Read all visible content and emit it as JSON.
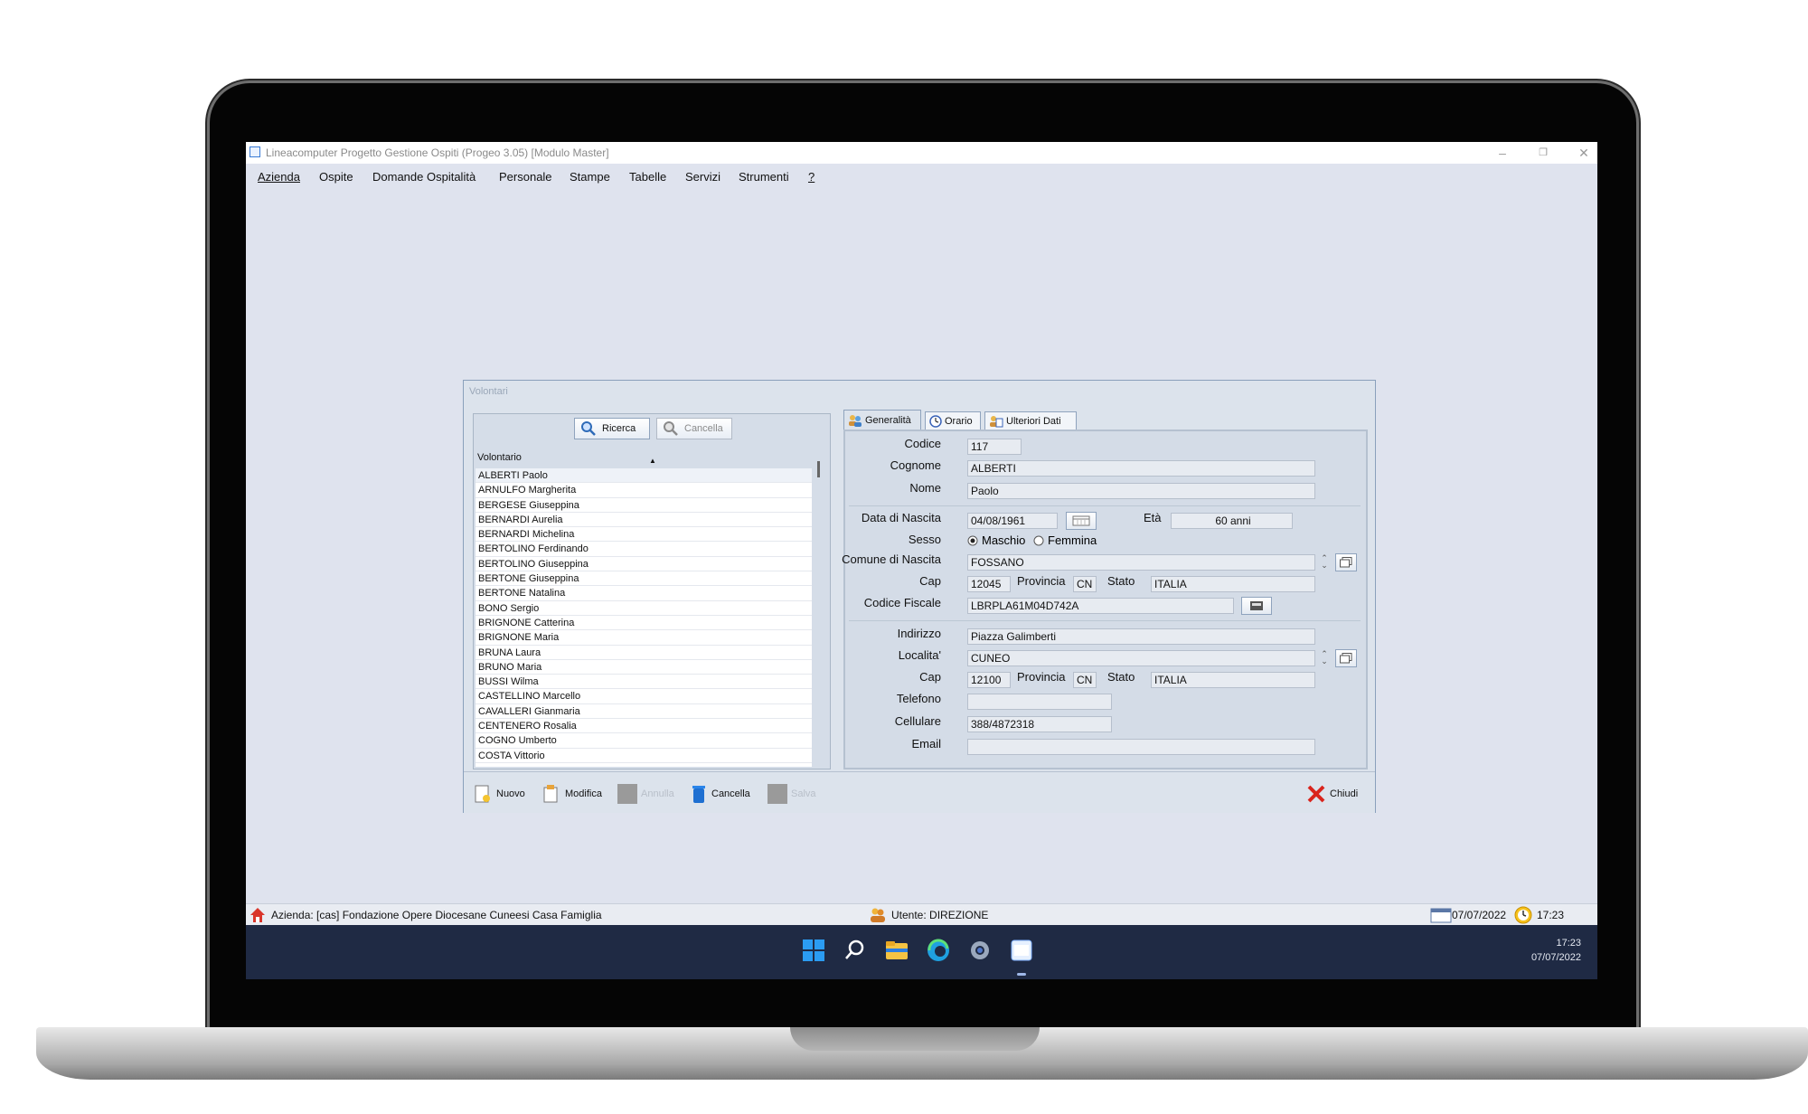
{
  "window": {
    "title": "Lineacomputer Progetto Gestione Ospiti (Progeo 3.05) [Modulo Master]",
    "controls": {
      "minimize": "–",
      "restore": "❐",
      "close": "✕"
    }
  },
  "menu": [
    "Azienda",
    "Ospite",
    "Domande Ospitalità",
    "Personale",
    "Stampe",
    "Tabelle",
    "Servizi",
    "Strumenti",
    "?"
  ],
  "dialog": {
    "title": "Volontari",
    "search_button": "Ricerca",
    "clear_button": "Cancella",
    "list_header": "Volontario",
    "volunteers": [
      "ALBERTI Paolo",
      "ARNULFO  Margherita",
      "BERGESE Giuseppina",
      "BERNARDI Aurelia",
      "BERNARDI Michelina",
      "BERTOLINO Ferdinando",
      "BERTOLINO Giuseppina",
      "BERTONE Giuseppina",
      "BERTONE Natalina",
      "BONO Sergio",
      "BRIGNONE  Catterina",
      "BRIGNONE Maria",
      "BRUNA Laura",
      "BRUNO Maria",
      "BUSSI Wilma",
      "CASTELLINO Marcello",
      "CAVALLERI Gianmaria",
      "CENTENERO Rosalia",
      "COGNO Umberto",
      "COSTA Vittorio"
    ],
    "tabs": [
      "Generalità",
      "Orario",
      "Ulteriori Dati"
    ],
    "form": {
      "codice_label": "Codice",
      "codice": "117",
      "cognome_label": "Cognome",
      "cognome": "ALBERTI",
      "nome_label": "Nome",
      "nome": "Paolo",
      "data_nascita_label": "Data di Nascita",
      "data_nascita": "04/08/1961",
      "eta_label": "Età",
      "eta": "60 anni",
      "sesso_label": "Sesso",
      "sesso_m": "Maschio",
      "sesso_f": "Femmina",
      "comune_label": "Comune di Nascita",
      "comune": "FOSSANO",
      "cap_label": "Cap",
      "cap_nascita": "12045",
      "provincia_label": "Provincia",
      "provincia_nascita": "CN",
      "stato_label": "Stato",
      "stato_nascita": "ITALIA",
      "cf_label": "Codice Fiscale",
      "cf": "LBRPLA61M04D742A",
      "indirizzo_label": "Indirizzo",
      "indirizzo": "Piazza Galimberti",
      "localita_label": "Localita'",
      "localita": "CUNEO",
      "cap_res": "12100",
      "provincia_res": "CN",
      "stato_res": "ITALIA",
      "telefono_label": "Telefono",
      "telefono": "",
      "cellulare_label": "Cellulare",
      "cellulare": "388/4872318",
      "email_label": "Email",
      "email": ""
    },
    "actions": {
      "nuovo": "Nuovo",
      "modifica": "Modifica",
      "annulla": "Annulla",
      "cancella": "Cancella",
      "salva": "Salva",
      "chiudi": "Chiudi"
    }
  },
  "status": {
    "azienda": "Azienda: [cas] Fondazione Opere Diocesane Cuneesi Casa Famiglia",
    "utente": "Utente: DIREZIONE",
    "date": "07/07/2022",
    "time": "17:23"
  },
  "taskbar": {
    "time": "17:23",
    "date": "07/07/2022"
  }
}
